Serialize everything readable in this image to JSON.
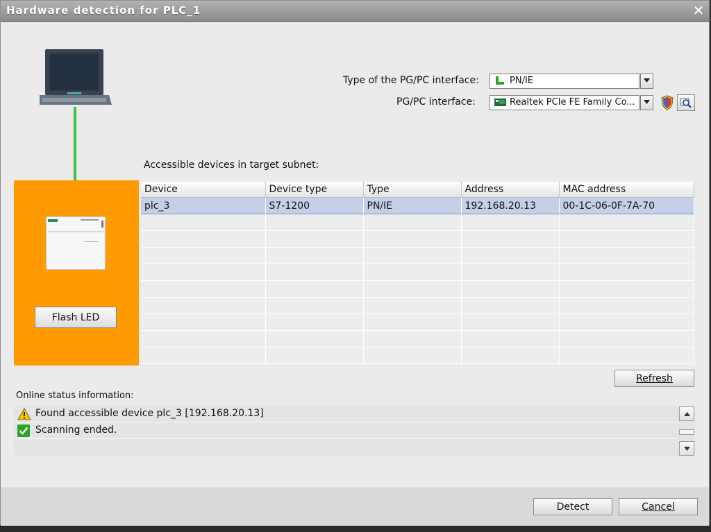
{
  "window": {
    "title": "Hardware detection for PLC_1",
    "close_glyph": "✕"
  },
  "interface": {
    "type_label": "Type of the PG/PC interface:",
    "type_value": "PN/IE",
    "type_icon": "network-plug-icon",
    "pgpc_label": "PG/PC interface:",
    "pgpc_value": "Realtek PCIe FE Family Co...",
    "pgpc_icon": "network-card-icon"
  },
  "devices": {
    "section_label": "Accessible devices in target subnet:",
    "columns": [
      "Device",
      "Device type",
      "Type",
      "Address",
      "MAC address"
    ],
    "rows": [
      [
        "plc_3",
        "S7-1200",
        "PN/IE",
        "192.168.20.13",
        "00-1C-06-0F-7A-70"
      ]
    ]
  },
  "buttons": {
    "flash_led": "Flash LED",
    "refresh": "Refresh",
    "detect": "Detect",
    "cancel": "Cancel"
  },
  "status": {
    "label": "Online status information:",
    "messages": [
      {
        "icon": "warning-icon",
        "text": "Found accessible device plc_3 [192.168.20.13]"
      },
      {
        "icon": "check-icon",
        "text": "Scanning ended."
      }
    ]
  },
  "colors": {
    "orange_panel": "#ff9a00",
    "cable_green": "#3cc23c",
    "selected_row": "#c4d0e7"
  }
}
